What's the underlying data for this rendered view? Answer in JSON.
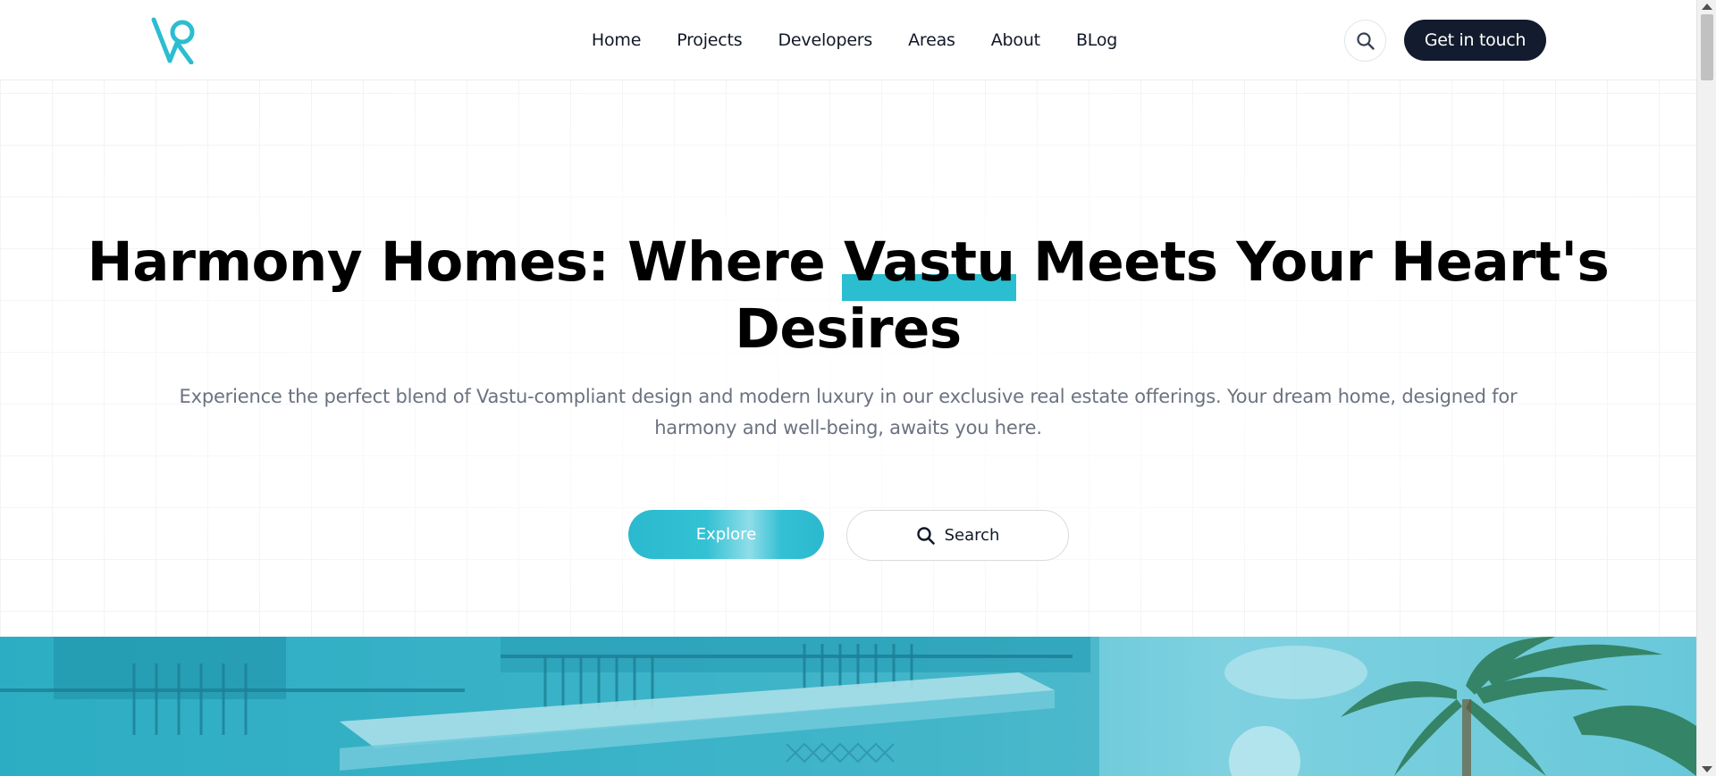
{
  "brand": {
    "logo_icon": "vastu-v-logo-icon",
    "accent_color": "#2bbdd0",
    "dark_color": "#131b2e"
  },
  "nav": {
    "items": [
      {
        "label": "Home"
      },
      {
        "label": "Projects"
      },
      {
        "label": "Developers"
      },
      {
        "label": "Areas"
      },
      {
        "label": "About"
      },
      {
        "label": "BLog"
      }
    ],
    "cta_label": "Get in touch",
    "search_icon": "search-icon"
  },
  "hero": {
    "title_before": "Harmony Homes: Where ",
    "title_highlight": "Vastu",
    "title_after": " Meets Your Heart's Desires",
    "subtitle": "Experience the perfect blend of Vastu-compliant design and modern luxury in our exclusive real estate offerings. Your dream home, designed for harmony and well-being, awaits you here.",
    "explore_label": "Explore",
    "search_label": "Search"
  }
}
